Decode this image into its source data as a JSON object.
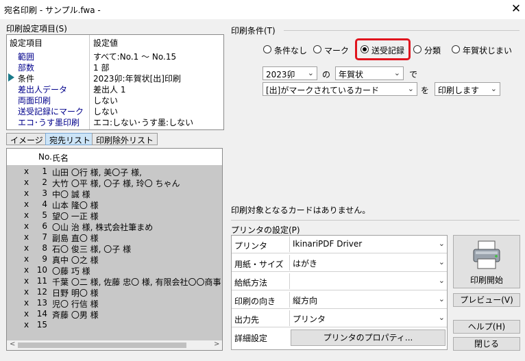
{
  "window": {
    "title": "宛名印刷 - サンプル.fwa -",
    "close_glyph": "✕"
  },
  "settings_section": {
    "label": "印刷設定項目(S)",
    "headers": [
      "設定項目",
      "設定値"
    ],
    "rows": [
      {
        "key": "範囲",
        "value": "すべて:No.1 〜 No.15"
      },
      {
        "key": "部数",
        "value": "1 部"
      },
      {
        "key": "条件",
        "value": "2023卯:年賀状[出]印刷"
      },
      {
        "key": "差出人データ",
        "value": "差出人 1"
      },
      {
        "key": "両面印刷",
        "value": "しない"
      },
      {
        "key": "送受記録にマーク",
        "value": "しない"
      },
      {
        "key": "エコ･うす墨印刷",
        "value": "エコ:しない･うす墨:しない"
      }
    ]
  },
  "tabs": [
    "イメージ",
    "宛先リスト",
    "印刷除外リスト"
  ],
  "list": {
    "headers": [
      "No.",
      "氏名"
    ],
    "rows": [
      {
        "x": "x",
        "no": "1",
        "name": "山田 〇行 様, 美〇子 様,"
      },
      {
        "x": "x",
        "no": "2",
        "name": "大竹 〇平 様, 〇子 様, 玲〇 ちゃん"
      },
      {
        "x": "x",
        "no": "3",
        "name": "中〇 誠 様"
      },
      {
        "x": "x",
        "no": "4",
        "name": "山本 隆〇 様"
      },
      {
        "x": "x",
        "no": "5",
        "name": "望〇 一正 様"
      },
      {
        "x": "x",
        "no": "6",
        "name": "〇山 治 様, 株式会社筆まめ"
      },
      {
        "x": "x",
        "no": "7",
        "name": "副島 直〇 様"
      },
      {
        "x": "x",
        "no": "8",
        "name": "石〇 俊三 様, 〇子 様"
      },
      {
        "x": "x",
        "no": "9",
        "name": "真中 〇之 様"
      },
      {
        "x": "x",
        "no": "10",
        "name": "〇藤 巧 様"
      },
      {
        "x": "x",
        "no": "11",
        "name": "千葉 〇二 様, 佐藤 忠〇 様, 有限会社〇〇商事"
      },
      {
        "x": "x",
        "no": "12",
        "name": "日野 明〇 様"
      },
      {
        "x": "x",
        "no": "13",
        "name": "児〇 行信 様"
      },
      {
        "x": "x",
        "no": "14",
        "name": "斉藤 〇男 様"
      },
      {
        "x": "x",
        "no": "15",
        "name": ""
      }
    ],
    "scroll_left": "<",
    "scroll_right": ">"
  },
  "conditions": {
    "label": "印刷条件(T)",
    "radios": [
      {
        "label": "条件なし",
        "selected": false
      },
      {
        "label": "マーク",
        "selected": false
      },
      {
        "label": "送受記録",
        "selected": true
      },
      {
        "label": "分類",
        "selected": false
      },
      {
        "label": "年賀状じまい",
        "selected": false
      }
    ],
    "year_select": "2023卯",
    "particle_no": "の",
    "type_select": "年賀状",
    "particle_de": "で",
    "mark_select": "[出]がマークされているカード",
    "particle_wo": "を",
    "action_select": "印刷します",
    "message": "印刷対象となるカードはありません。"
  },
  "printer": {
    "label": "プリンタの設定(P)",
    "rows": [
      {
        "key": "プリンタ",
        "value": "IkinariPDF Driver",
        "dropdown": true
      },
      {
        "key": "用紙・サイズ",
        "value": "はがき",
        "dropdown": true
      },
      {
        "key": "給紙方法",
        "value": "",
        "dropdown": true
      },
      {
        "key": "印刷の向き",
        "value": "縦方向",
        "dropdown": true
      },
      {
        "key": "出力先",
        "value": "プリンタ",
        "dropdown": true
      }
    ],
    "detail_key": "詳細設定",
    "properties_button": "プリンタのプロパティ..."
  },
  "buttons": {
    "print": "印刷開始",
    "preview": "プレビュー(V)",
    "help": "ヘルプ(H)",
    "close": "閉じる"
  },
  "colors": {
    "highlight": "#e0141e",
    "selected_tab": "#cce4f7",
    "list_bg": "#c8c8c8"
  }
}
